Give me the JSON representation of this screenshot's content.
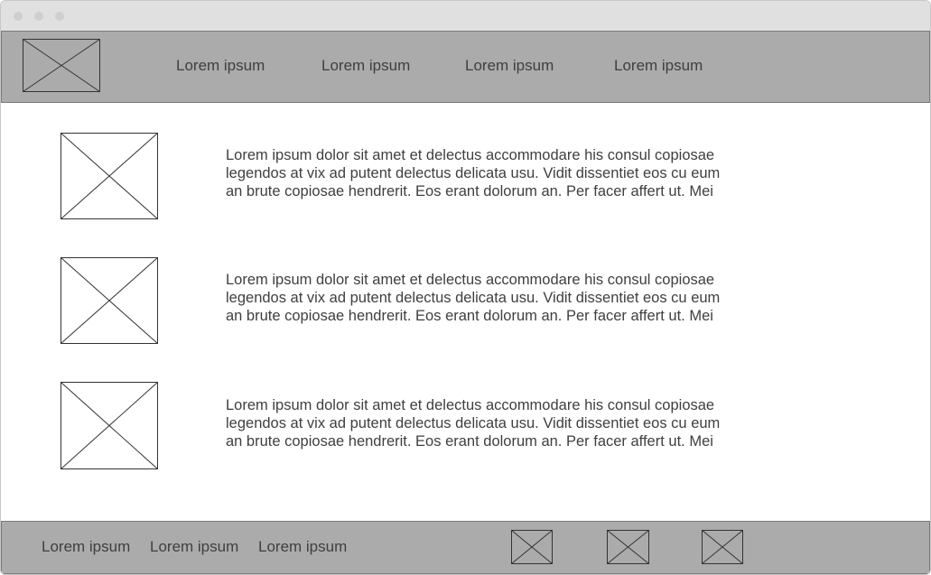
{
  "header": {
    "nav": [
      {
        "label": "Lorem ipsum"
      },
      {
        "label": "Lorem ipsum"
      },
      {
        "label": "Lorem ipsum"
      },
      {
        "label": "Lorem ipsum"
      }
    ]
  },
  "content": {
    "items": [
      {
        "text": "Lorem ipsum dolor sit amet et delectus accommodare his consul copiosae\nlegendos at vix ad putent delectus delicata usu. Vidit dissentiet eos cu eum\nan brute copiosae hendrerit. Eos erant dolorum an. Per facer affert ut. Mei"
      },
      {
        "text": "Lorem ipsum dolor sit amet et delectus accommodare his consul copiosae\nlegendos at vix ad putent delectus delicata usu. Vidit dissentiet eos cu eum\nan brute copiosae hendrerit. Eos erant dolorum an. Per facer affert ut. Mei"
      },
      {
        "text": "Lorem ipsum dolor sit amet et delectus accommodare his consul copiosae\nlegendos at vix ad putent delectus delicata usu. Vidit dissentiet eos cu eum\nan brute copiosae hendrerit. Eos erant dolorum an. Per facer affert ut. Mei"
      }
    ]
  },
  "footer": {
    "links": [
      {
        "label": "Lorem ipsum"
      },
      {
        "label": "Lorem ipsum"
      },
      {
        "label": "Lorem ipsum"
      }
    ]
  },
  "colors": {
    "titlebar": "#e0e0e0",
    "header_bg": "#ababab",
    "footer_bg": "#ababab",
    "text": "#3f3f3f",
    "placeholder_stroke": "#333333"
  },
  "icons": {
    "placeholder": "image-placeholder-icon",
    "window_control": "window-dot-icon"
  }
}
